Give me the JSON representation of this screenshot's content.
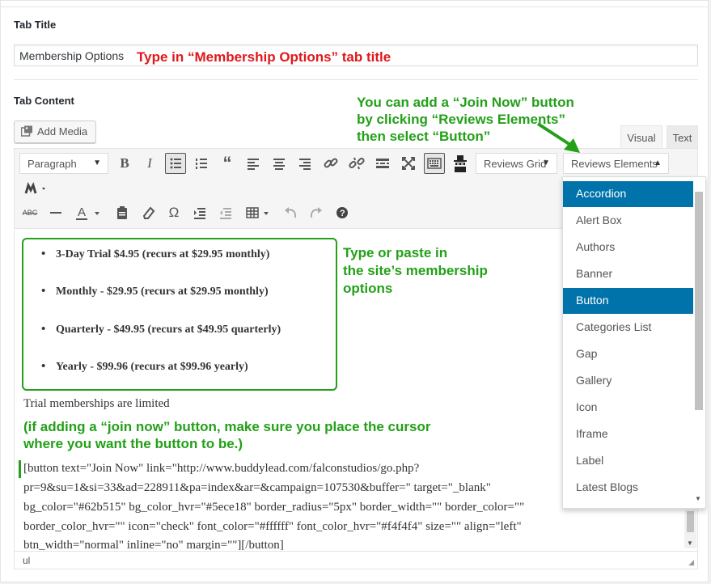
{
  "tab_title": {
    "label": "Tab Title",
    "value": "Membership Options",
    "annotation": "Type in “Membership Options” tab title"
  },
  "tab_content": {
    "label": "Tab Content",
    "add_media_label": "Add Media",
    "annotation_join": "You can add a “Join Now” button\nby clicking “Reviews Elements”\nthen select “Button”",
    "editor_tabs": [
      {
        "label": "Visual"
      },
      {
        "label": "Text"
      }
    ]
  },
  "toolbar": {
    "format_select": "Paragraph",
    "reviews_grid": "Reviews Grid",
    "reviews_elements": "Reviews Elements",
    "icons": [
      "bold-icon",
      "italic-icon",
      "bullet-list-icon",
      "numbered-list-icon",
      "blockquote-icon",
      "align-left-icon",
      "align-center-icon",
      "align-right-icon",
      "link-icon",
      "unlink-icon",
      "read-more-icon",
      "fullscreen-icon",
      "toolbar-toggle-icon",
      "spy-icon",
      "shortcode-icon",
      "strikethrough-icon",
      "horizontal-line-icon",
      "text-color-icon",
      "paste-text-icon",
      "clear-formatting-icon",
      "special-character-icon",
      "indent-icon",
      "outdent-icon",
      "table-icon",
      "undo-icon",
      "redo-icon",
      "help-icon"
    ]
  },
  "dropdown": {
    "items": [
      {
        "label": "Accordion",
        "selected": true
      },
      {
        "label": "Alert Box",
        "selected": false
      },
      {
        "label": "Authors",
        "selected": false
      },
      {
        "label": "Banner",
        "selected": false
      },
      {
        "label": "Button",
        "selected": true
      },
      {
        "label": "Categories List",
        "selected": false
      },
      {
        "label": "Gap",
        "selected": false
      },
      {
        "label": "Gallery",
        "selected": false
      },
      {
        "label": "Icon",
        "selected": false
      },
      {
        "label": "Iframe",
        "selected": false
      },
      {
        "label": "Label",
        "selected": false
      },
      {
        "label": "Latest Blogs",
        "selected": false
      }
    ]
  },
  "content": {
    "plans": [
      "3-Day Trial $4.95 (recurs at $29.95 monthly)",
      "Monthly - $29.95 (recurs at $29.95 monthly)",
      "Quarterly - $49.95 (recurs at $49.95 quarterly)",
      "Yearly - $99.96 (recurs at $99.96 yearly)"
    ],
    "annotation_paste": "Type or paste in\nthe site’s membership\noptions",
    "trial_note": "Trial memberships are limited",
    "annotation_cursor": "(if adding a “join now” button, make sure you place the cursor\nwhere you want the button to be.)",
    "shortcode_lines": [
      "[button text=\"Join Now\" link=\"http://www.buddylead.com/falconstudios/go.php?",
      "pr=9&su=1&si=33&ad=228911&pa=index&ar=&campaign=107530&buffer=\" target=\"_blank\"",
      "bg_color=\"#62b515\" bg_color_hvr=\"#5ece18\" border_radius=\"5px\" border_width=\"\" border_color=\"\"",
      "border_color_hvr=\"\" icon=\"check\" font_color=\"#ffffff\" font_color_hvr=\"#f4f4f4\" size=\"\" align=\"left\"",
      "btn_width=\"normal\" inline=\"no\" margin=\"\"][/button]"
    ],
    "status_path": "ul"
  },
  "colors": {
    "annotation_red": "#e0181b",
    "annotation_green": "#23a018",
    "selected_blue": "#0073aa"
  }
}
